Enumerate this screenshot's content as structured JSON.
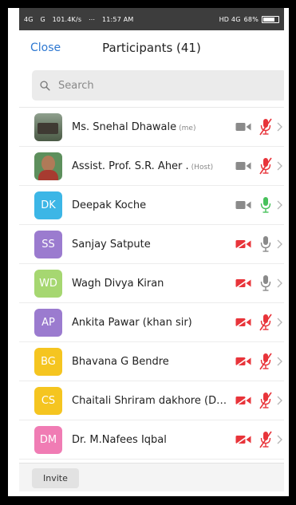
{
  "status_bar": {
    "network1": "4G",
    "network2": "G",
    "speed": "101.4K/s",
    "time": "11:57 AM",
    "extra": "HD 4G",
    "battery": "68%"
  },
  "header": {
    "close_label": "Close",
    "title": "Participants (41)"
  },
  "search": {
    "placeholder": "Search"
  },
  "participants": [
    {
      "name": "Ms. Snehal Dhawale",
      "tag": "(me)",
      "initials": "",
      "avatar_type": "photo1",
      "color": "",
      "video": "on",
      "mic": "muted"
    },
    {
      "name": "Assist. Prof. S.R. Aher .",
      "tag": "(Host)",
      "initials": "",
      "avatar_type": "photo2",
      "color": "",
      "video": "on",
      "mic": "muted"
    },
    {
      "name": "Deepak Koche",
      "tag": "",
      "initials": "DK",
      "avatar_type": "initials",
      "color": "#3cb6e6",
      "video": "on",
      "mic": "active"
    },
    {
      "name": "Sanjay Satpute",
      "tag": "",
      "initials": "SS",
      "avatar_type": "initials",
      "color": "#9b7bcf",
      "video": "off",
      "mic": "idle"
    },
    {
      "name": "Wagh Divya Kiran",
      "tag": "",
      "initials": "WD",
      "avatar_type": "initials",
      "color": "#a6d771",
      "video": "off",
      "mic": "idle"
    },
    {
      "name": "Ankita Pawar (khan sir)",
      "tag": "",
      "initials": "AP",
      "avatar_type": "initials",
      "color": "#9b7bcf",
      "video": "off",
      "mic": "muted"
    },
    {
      "name": "Bhavana G Bendre",
      "tag": "",
      "initials": "BG",
      "avatar_type": "initials",
      "color": "#f5c520",
      "video": "off",
      "mic": "muted"
    },
    {
      "name": "Chaitali Shriram dakhore (Dhanw...",
      "tag": "",
      "initials": "CS",
      "avatar_type": "initials",
      "color": "#f5c520",
      "video": "off",
      "mic": "muted"
    },
    {
      "name": "Dr. M.Nafees Iqbal",
      "tag": "",
      "initials": "DM",
      "avatar_type": "initials",
      "color": "#f07cb4",
      "video": "off",
      "mic": "muted"
    }
  ],
  "footer": {
    "invite_label": "Invite"
  },
  "colors": {
    "accent": "#2e78d1",
    "muted_red": "#e8343a",
    "active_green": "#47c15b",
    "icon_gray": "#8a8a8a"
  }
}
